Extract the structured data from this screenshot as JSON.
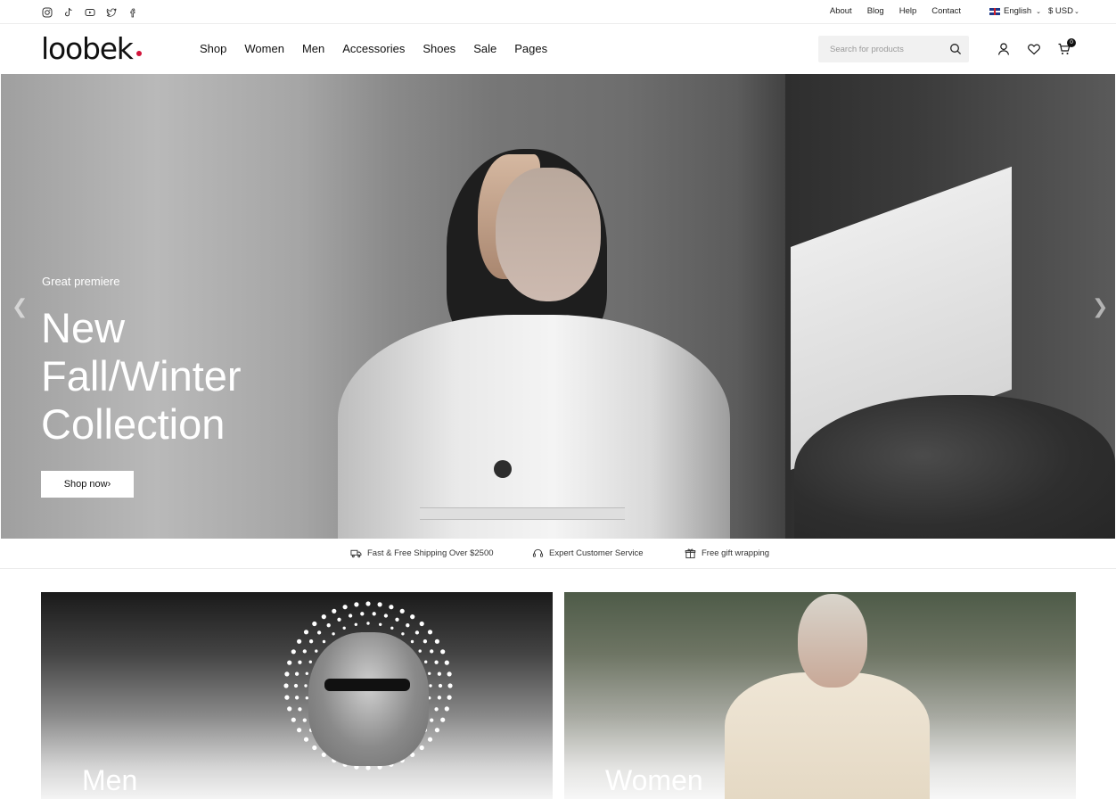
{
  "topbar": {
    "social": [
      "instagram-icon",
      "tiktok-icon",
      "youtube-icon",
      "twitter-icon",
      "facebook-icon"
    ],
    "links": [
      "About",
      "Blog",
      "Help",
      "Contact"
    ],
    "language": "English",
    "currency": "$ USD"
  },
  "header": {
    "logo": "loobek",
    "nav": [
      "Shop",
      "Women",
      "Men",
      "Accessories",
      "Shoes",
      "Sale",
      "Pages"
    ],
    "search_placeholder": "Search for products",
    "cart_count": "0",
    "accent": "#d2143a"
  },
  "hero": {
    "eyebrow": "Great premiere",
    "line1": "New",
    "line2": "Fall/Winter",
    "line3": "Collection",
    "cta": "Shop now"
  },
  "features": [
    {
      "icon": "truck-icon",
      "text": "Fast & Free Shipping Over $2500"
    },
    {
      "icon": "headset-icon",
      "text": "Expert Customer Service"
    },
    {
      "icon": "gift-icon",
      "text": "Free gift wrapping"
    }
  ],
  "categories": [
    {
      "label": "Men"
    },
    {
      "label": "Women"
    }
  ]
}
